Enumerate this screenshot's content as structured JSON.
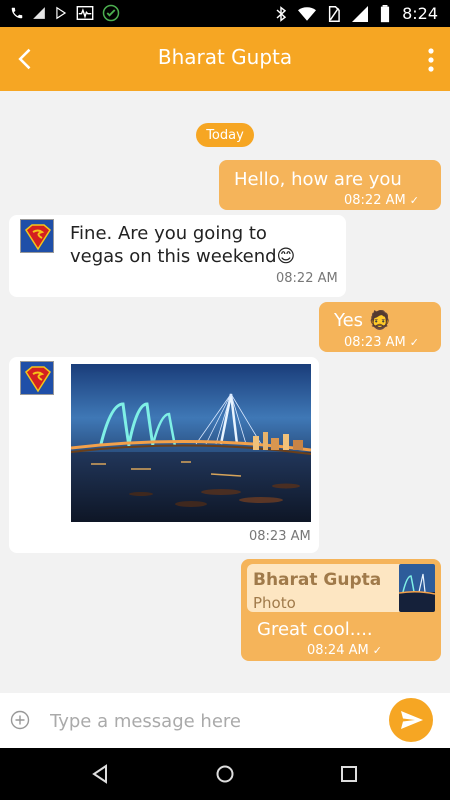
{
  "status_bar": {
    "time": "8:24",
    "icons": [
      "phone-icon",
      "signal-icon",
      "play-store-icon",
      "pulse-icon",
      "check-circle-icon",
      "bluetooth-icon",
      "wifi-icon",
      "no-sim-icon",
      "cell-signal-icon",
      "battery-icon"
    ]
  },
  "header": {
    "title": "Bharat Gupta",
    "back_icon": "chevron-left-icon",
    "menu_icon": "kebab-menu-icon"
  },
  "chat": {
    "date_label": "Today",
    "messages": [
      {
        "direction": "out",
        "text": "Hello, how are you",
        "time": "08:22 AM"
      },
      {
        "direction": "in",
        "text_line1": "Fine. Are you going to",
        "text_line2": "vegas on this weekend😊",
        "time": "08:22 AM",
        "avatar": "superman-avatar"
      },
      {
        "direction": "out",
        "text": "Yes 🧔",
        "time": "08:23 AM"
      },
      {
        "direction": "in",
        "type": "photo",
        "time": "08:23 AM",
        "avatar": "superman-avatar"
      },
      {
        "direction": "out",
        "reply_name": "Bharat Gupta",
        "reply_type": "Photo",
        "text": "Great cool....",
        "time": "08:24 AM"
      }
    ]
  },
  "composer": {
    "placeholder": "Type a message here",
    "value": ""
  },
  "colors": {
    "accent": "#f6a623",
    "bubble_out": "#f5b45a",
    "bubble_in": "#ffffff",
    "background": "#f2f2f2"
  }
}
